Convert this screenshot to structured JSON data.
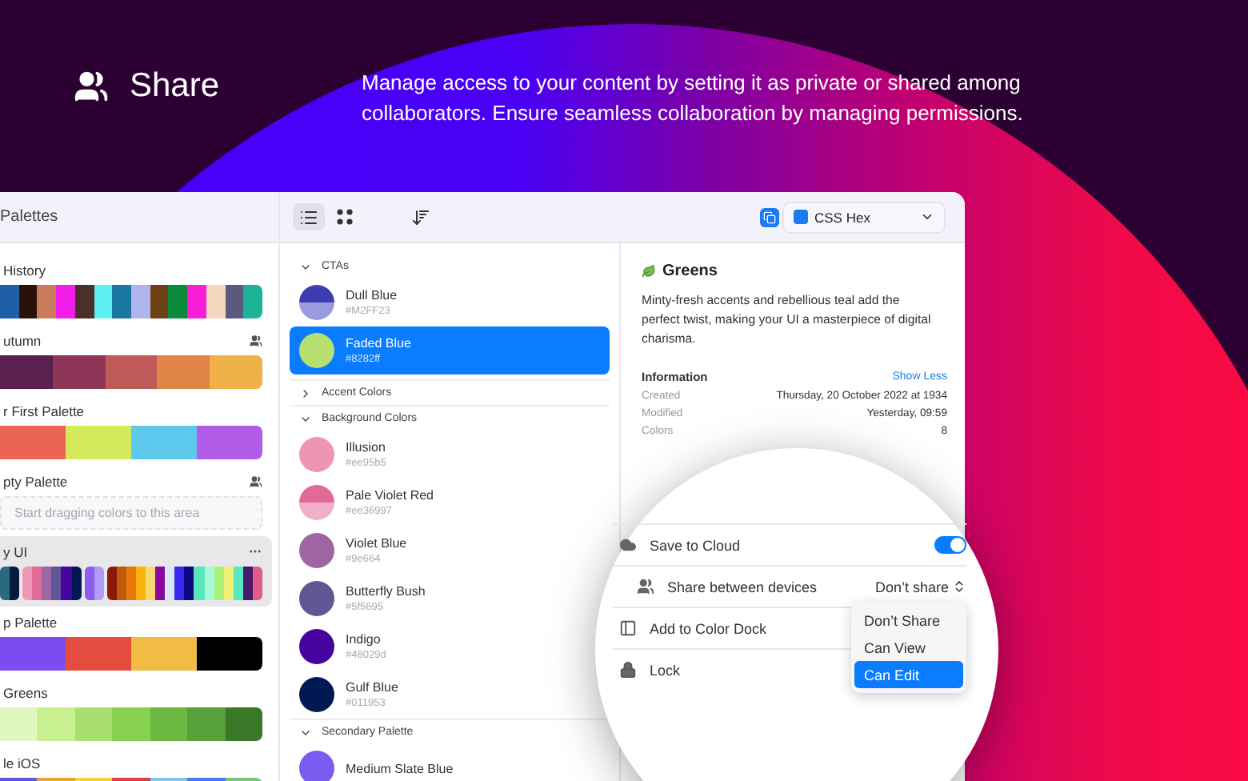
{
  "header": {
    "title": "Share",
    "description": "Manage access to your content by setting it as private or shared among collaborators. Ensure seamless collaboration by managing permissions."
  },
  "toolbar": {
    "views": [
      {
        "kind": "list",
        "selected": true
      },
      {
        "kind": "grid",
        "selected": false
      }
    ],
    "format": "CSS Hex"
  },
  "sidebar": {
    "title": "Palettes",
    "palettes": [
      {
        "kind": "strip",
        "name": "History",
        "shared": false,
        "selected": false,
        "cells": [
          {
            "color": "#1f5fa8"
          },
          {
            "color": "#2a1208"
          },
          {
            "color": "#c97c5d"
          },
          {
            "color": "#f01ee8"
          },
          {
            "color": "#4a3028"
          },
          {
            "color": "#5ef0f0"
          },
          {
            "color": "#1a78a0"
          },
          {
            "color": "#b0b4ec"
          },
          {
            "color": "#6e4016"
          },
          {
            "color": "#0a8a3a"
          },
          {
            "color": "#f81ed8"
          },
          {
            "color": "#f4d8be"
          },
          {
            "color": "#5a5a80"
          },
          {
            "color": "#1cb496"
          }
        ]
      },
      {
        "kind": "strip",
        "name": "utumn",
        "shared": true,
        "selected": false,
        "cells": [
          {
            "color": "#5a2050"
          },
          {
            "color": "#8e3658"
          },
          {
            "color": "#c05a58"
          },
          {
            "color": "#e08448"
          },
          {
            "color": "#f0b248"
          }
        ]
      },
      {
        "kind": "strip",
        "name": "r First Palette",
        "shared": false,
        "selected": false,
        "cells": [
          {
            "color": "#ec6454"
          },
          {
            "color": "#d4ea5c"
          },
          {
            "color": "#5cc8ec"
          },
          {
            "color": "#b05ce8"
          }
        ]
      },
      {
        "kind": "empty",
        "name": "pty Palette",
        "shared": true,
        "selected": false,
        "placeholder": "Start dragging colors to this area"
      },
      {
        "kind": "groups",
        "name": "y UI",
        "shared": false,
        "selected": true,
        "groups": [
          {
            "cells": [
              {
                "color": "#2a6a80"
              },
              {
                "color": "#0a1840"
              }
            ]
          },
          {
            "cells": [
              {
                "color": "#ec98b6"
              },
              {
                "color": "#e06a98"
              },
              {
                "color": "#9e66a4"
              },
              {
                "color": "#5f5695"
              },
              {
                "color": "#48029d"
              },
              {
                "color": "#011953"
              }
            ]
          },
          {
            "cells": [
              {
                "color": "#8a5cf0"
              },
              {
                "color": "#b49af8"
              }
            ]
          },
          {
            "cells": [
              {
                "color": "#8a1a0a"
              },
              {
                "color": "#c05a0a"
              },
              {
                "color": "#e8780a"
              },
              {
                "color": "#f8b40a"
              },
              {
                "color": "#fcd870"
              },
              {
                "color": "#8a0aa0"
              },
              {
                "color": "#d8e8f8"
              },
              {
                "color": "#3a2af0"
              },
              {
                "color": "#0a0a80"
              },
              {
                "color": "#5ae8b8"
              },
              {
                "color": "#a8f8d8"
              },
              {
                "color": "#a8f078"
              },
              {
                "color": "#f0f078"
              },
              {
                "color": "#5ae8c0"
              },
              {
                "color": "#4a1a6a"
              },
              {
                "color": "#e05a8a"
              }
            ]
          }
        ]
      },
      {
        "kind": "strip",
        "name": "p Palette",
        "shared": false,
        "selected": false,
        "cells": [
          {
            "color": "#7c4cf0"
          },
          {
            "color": "#e44c40"
          },
          {
            "color": "#f0bc44"
          },
          {
            "color": "#000000"
          }
        ]
      },
      {
        "kind": "strip",
        "name": "Greens",
        "shared": false,
        "selected": false,
        "cells": [
          {
            "color": "#e0f8c0"
          },
          {
            "color": "#c8f090"
          },
          {
            "color": "#a8e070"
          },
          {
            "color": "#88d050"
          },
          {
            "color": "#6ab840"
          },
          {
            "color": "#58a038"
          },
          {
            "color": "#3a7828"
          }
        ]
      },
      {
        "kind": "strip",
        "name": "le iOS",
        "shared": false,
        "selected": false,
        "cells": [
          {
            "color": "#5a5ad8"
          },
          {
            "color": "#f0a030"
          },
          {
            "color": "#f8d040"
          },
          {
            "color": "#e04040"
          },
          {
            "color": "#78c8f0"
          },
          {
            "color": "#3a80f0"
          },
          {
            "color": "#70c870"
          }
        ]
      }
    ]
  },
  "list": {
    "sections": [
      {
        "title": "CTAs",
        "expanded": true,
        "colors": [
          {
            "name": "Dull Blue",
            "hex": "#M2FF23",
            "swatch": [
              {
                "color": "#3d3db0"
              },
              {
                "color": "#9a9ade"
              }
            ],
            "selected": false
          },
          {
            "name": "Faded Blue",
            "hex": "#8282ff",
            "swatch": [
              {
                "color": "#b8e070"
              }
            ],
            "selected": true
          }
        ]
      },
      {
        "title": "Accent Colors",
        "expanded": false
      },
      {
        "title": "Background Colors",
        "expanded": true,
        "colors": [
          {
            "name": "Illusion",
            "hex": "#ee95b5",
            "swatch": [
              {
                "color": "#ee95b5"
              }
            ],
            "selected": false
          },
          {
            "name": "Pale Violet Red",
            "hex": "#ee36997",
            "swatch": [
              {
                "color": "#e06a98"
              },
              {
                "color": "#f0b0c8"
              }
            ],
            "selected": false
          },
          {
            "name": "Violet Blue",
            "hex": "#9e664",
            "swatch": [
              {
                "color": "#9e64a4"
              }
            ],
            "selected": false
          },
          {
            "name": "Butterfly Bush",
            "hex": "#5f5695",
            "swatch": [
              {
                "color": "#5f5695"
              }
            ],
            "selected": false
          },
          {
            "name": "Indigo",
            "hex": "#48029d",
            "swatch": [
              {
                "color": "#48029d"
              }
            ],
            "selected": false
          },
          {
            "name": "Gulf Blue",
            "hex": "#011953",
            "swatch": [
              {
                "color": "#011953"
              }
            ],
            "selected": false
          }
        ]
      },
      {
        "title": "Secondary Palette",
        "expanded": true,
        "colors": [
          {
            "name": "Medium Slate Blue",
            "swatch": [
              {
                "color": "#7b5cf0"
              }
            ],
            "selected": false
          }
        ]
      }
    ]
  },
  "detail": {
    "title": "Greens",
    "description": "Minty-fresh accents and rebellious teal add the perfect twist, making your UI a masterpiece of digital charisma.",
    "info_title": "Information",
    "info_toggle": "Show Less",
    "rows": [
      {
        "label": "Created",
        "value": "Thursday, 20 October 2022 at 1934"
      },
      {
        "label": "Modified",
        "value": "Yesterday, 09:59"
      },
      {
        "label": "Colors",
        "value": "8"
      }
    ]
  },
  "magnifier": {
    "settings": [
      {
        "kind": "toggle",
        "label": "Save to Cloud",
        "on": true
      },
      {
        "kind": "select",
        "label": "Share between devices",
        "value": "Don’t share"
      },
      {
        "kind": "dock",
        "label": "Add to Color Dock"
      },
      {
        "kind": "lock",
        "label": "Lock"
      }
    ],
    "menu": [
      {
        "label": "Don’t Share",
        "selected": false
      },
      {
        "label": "Can View",
        "selected": false
      },
      {
        "label": "Can Edit",
        "selected": true
      }
    ]
  }
}
